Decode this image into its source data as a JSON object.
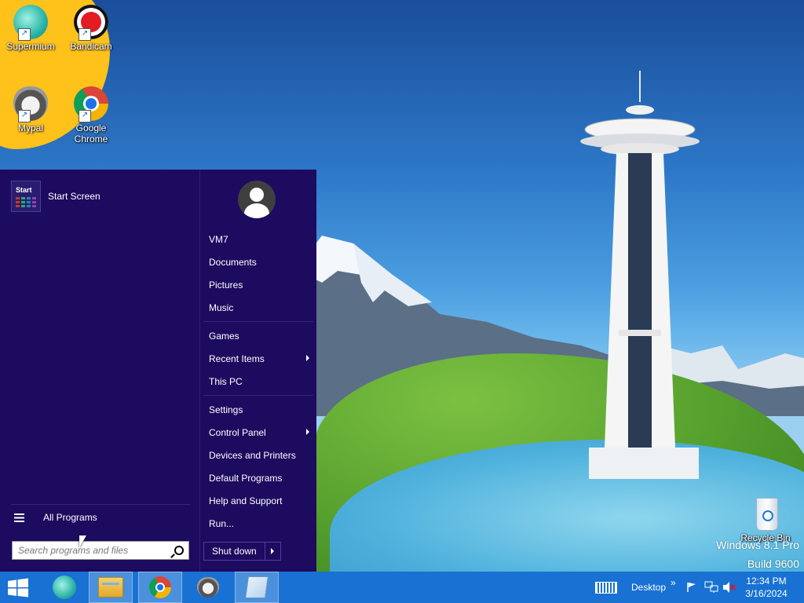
{
  "desktop": {
    "icons": [
      {
        "label": "Supermium"
      },
      {
        "label": "Bandicam"
      },
      {
        "label": "Mypal"
      },
      {
        "label": "Google Chrome"
      },
      {
        "label": "Recycle Bin"
      }
    ],
    "watermark": {
      "line1": "Windows 8.1 Pro",
      "line2": "Build 9600"
    }
  },
  "start_menu": {
    "pinned": [
      {
        "label": "Start Screen",
        "tile_text": "Start"
      }
    ],
    "all_programs_label": "All Programs",
    "search": {
      "placeholder": "Search programs and files"
    },
    "right_links": [
      {
        "label": "VM7"
      },
      {
        "label": "Documents"
      },
      {
        "label": "Pictures"
      },
      {
        "label": "Music"
      },
      {
        "label": "Games"
      },
      {
        "label": "Recent Items",
        "submenu": true
      },
      {
        "label": "This PC"
      },
      {
        "label": "Settings"
      },
      {
        "label": "Control Panel",
        "submenu": true
      },
      {
        "label": "Devices and Printers"
      },
      {
        "label": "Default Programs"
      },
      {
        "label": "Help and Support"
      },
      {
        "label": "Run..."
      }
    ],
    "shutdown_label": "Shut down"
  },
  "taskbar": {
    "pinned_icons": [
      "supermium-icon",
      "file-explorer-icon",
      "chrome-icon",
      "mypal-icon",
      "notepad-icon"
    ],
    "tray": {
      "desktop_toolbar_label": "Desktop",
      "overflow_label": "»",
      "time": "12:34 PM",
      "date": "3/16/2024"
    }
  },
  "colors": {
    "start_menu_bg": "#1d0b5f",
    "taskbar_bg": "#1871d3",
    "accent_yellow": "#ffc21a"
  }
}
